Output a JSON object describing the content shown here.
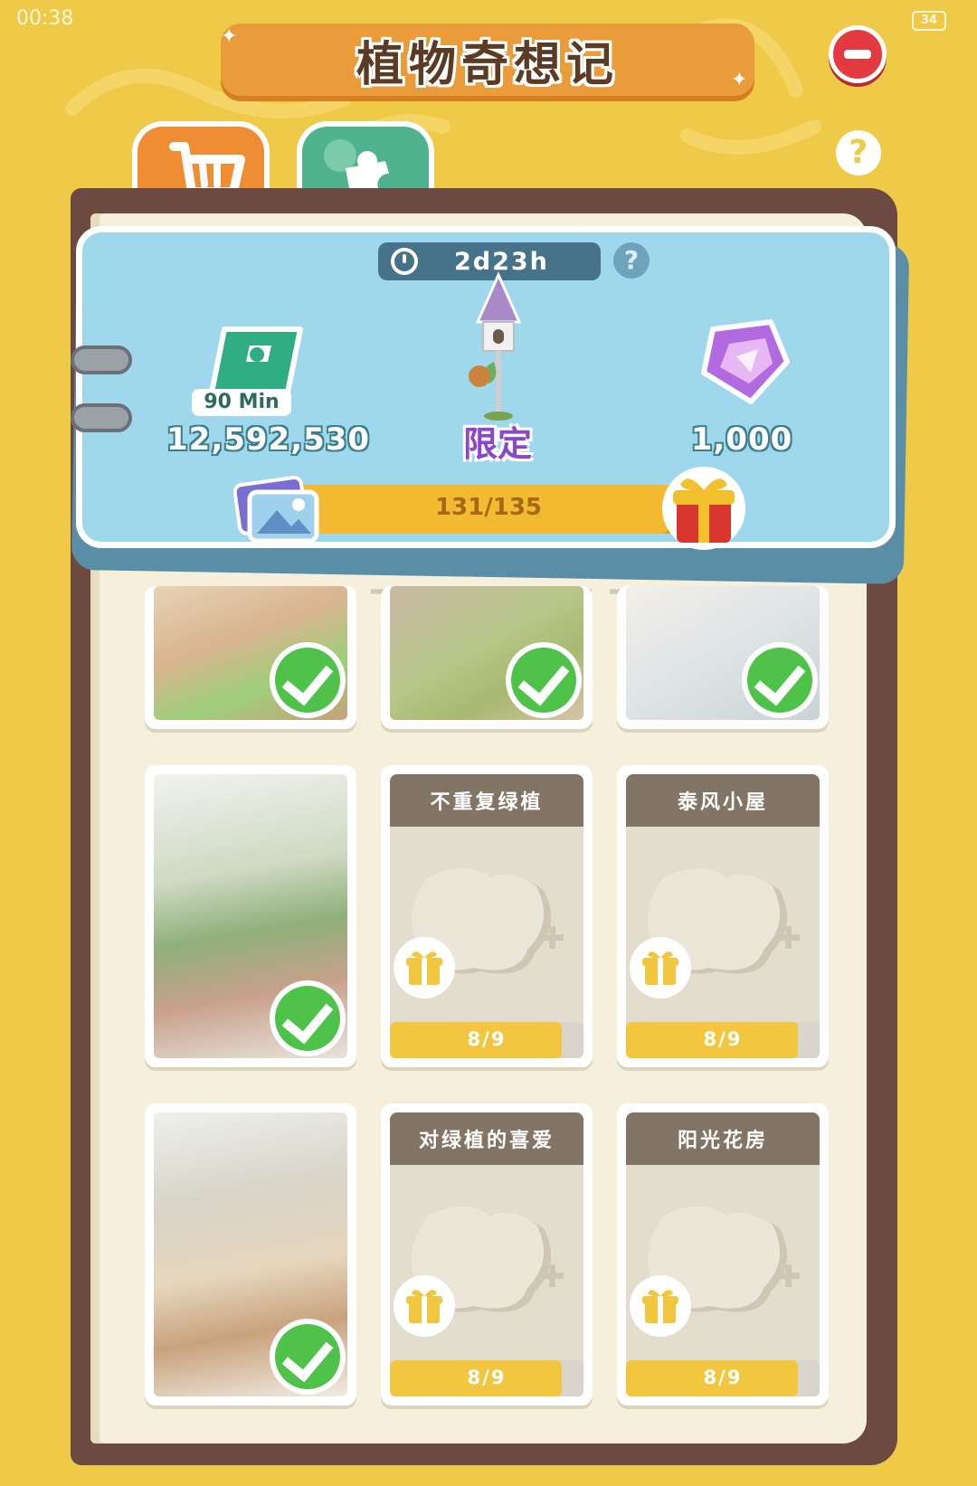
{
  "status_bar": {
    "time": "00:38",
    "battery": "34"
  },
  "header": {
    "title": "植物奇想记"
  },
  "tabs": [
    {
      "id": "shop",
      "icon": "shopping-cart-icon",
      "color": "#ef8d33"
    },
    {
      "id": "puzzle",
      "icon": "puzzle-piece-icon",
      "color": "#4fb38f"
    }
  ],
  "event": {
    "timer": "2d23h",
    "rewards": [
      {
        "id": "ticket",
        "badge": "90 Min",
        "value": "12,592,530"
      },
      {
        "id": "birdhouse",
        "value": "限定"
      },
      {
        "id": "gem",
        "value": "1,000"
      }
    ],
    "progress": {
      "label": "131/135",
      "current": 131,
      "total": 135
    }
  },
  "cards": [
    {
      "type": "completed",
      "scene": "garden-lounge"
    },
    {
      "type": "completed",
      "scene": "study-corner"
    },
    {
      "type": "completed",
      "scene": "white-kitchen"
    },
    {
      "type": "completed",
      "scene": "cactus-patio"
    },
    {
      "type": "locked",
      "title": "不重复绿植",
      "progress_label": "8/9",
      "current": 8,
      "total": 9
    },
    {
      "type": "locked",
      "title": "泰风小屋",
      "progress_label": "8/9",
      "current": 8,
      "total": 9
    },
    {
      "type": "completed",
      "scene": "cozy-living-room"
    },
    {
      "type": "locked",
      "title": "对绿植的喜爱",
      "progress_label": "8/9",
      "current": 8,
      "total": 9
    },
    {
      "type": "locked",
      "title": "阳光花房",
      "progress_label": "8/9",
      "current": 8,
      "total": 9
    }
  ],
  "colors": {
    "background": "#efc948",
    "panel": "#9fd7ec",
    "progress": "#f2b931",
    "check": "#4fc24a",
    "locked_header": "#837565"
  }
}
